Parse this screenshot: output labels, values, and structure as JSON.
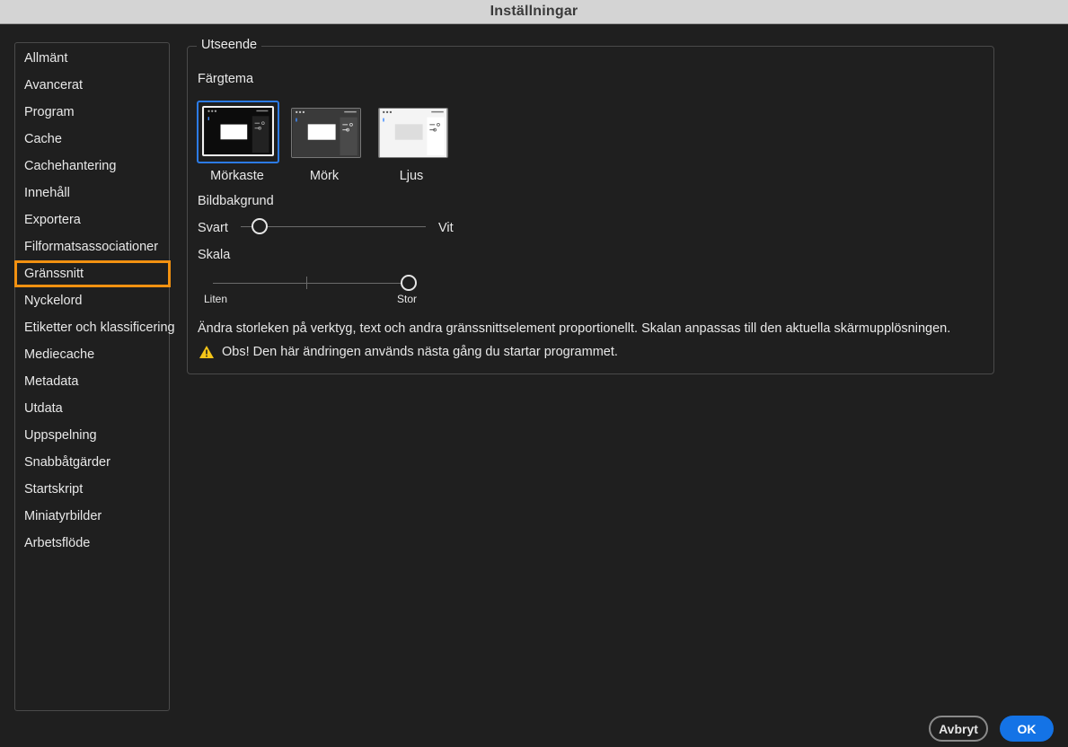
{
  "window": {
    "title": "Inställningar"
  },
  "sidebar": {
    "items": [
      {
        "label": "Allmänt"
      },
      {
        "label": "Avancerat"
      },
      {
        "label": "Program"
      },
      {
        "label": "Cache"
      },
      {
        "label": "Cachehantering"
      },
      {
        "label": "Innehåll"
      },
      {
        "label": "Exportera"
      },
      {
        "label": "Filformatsassociationer"
      },
      {
        "label": "Gränssnitt",
        "selected": true
      },
      {
        "label": "Nyckelord"
      },
      {
        "label": "Etiketter och klassificering"
      },
      {
        "label": "Mediecache"
      },
      {
        "label": "Metadata"
      },
      {
        "label": "Utdata"
      },
      {
        "label": "Uppspelning"
      },
      {
        "label": "Snabbåtgärder"
      },
      {
        "label": "Startskript"
      },
      {
        "label": "Miniatyrbilder"
      },
      {
        "label": "Arbetsflöde"
      }
    ],
    "selected_color": "#f29111"
  },
  "appearance": {
    "legend": "Utseende",
    "color_theme_label": "Färgtema",
    "themes": [
      {
        "label": "Mörkaste",
        "selected": true,
        "icon": "darkest-theme-thumbnail"
      },
      {
        "label": "Mörk",
        "selected": false,
        "icon": "dark-theme-thumbnail"
      },
      {
        "label": "Ljus",
        "selected": false,
        "icon": "light-theme-thumbnail"
      }
    ],
    "image_background_label": "Bildbakgrund",
    "image_background_min": "Svart",
    "image_background_max": "Vit",
    "image_background_value": 0.1,
    "scale_label": "Skala",
    "scale_min": "Liten",
    "scale_max": "Stor",
    "scale_value": 1.0,
    "description": "Ändra storleken på verktyg, text och andra gränssnittselement proportionellt. Skalan anpassas till den aktuella skärmupplösningen.",
    "warning": "Obs! Den här ändringen används nästa gång du startar programmet.",
    "warning_color": "#f5c518"
  },
  "buttons": {
    "cancel": "Avbryt",
    "ok": "OK",
    "accent": "#1473e6"
  }
}
